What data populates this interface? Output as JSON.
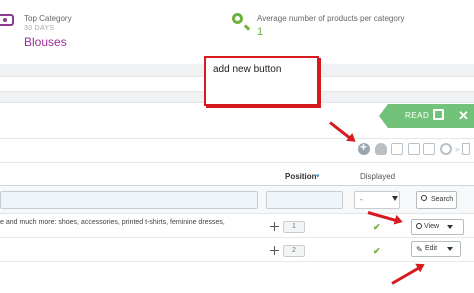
{
  "kpis": {
    "top_category": {
      "label": "Top Category",
      "period": "30 DAYS",
      "value": "Blouses"
    },
    "avg_products": {
      "label": "Average number of products per category",
      "value": "1"
    }
  },
  "panel": {
    "read_label": "READ",
    "toolbar_sql": ">_"
  },
  "table": {
    "headers": {
      "position": "Position",
      "displayed": "Displayed"
    },
    "filter": {
      "displayed_value": "-",
      "search_label": "Search"
    },
    "rows": [
      {
        "description": "e and much more: shoes, accessories, printed t-shirts, feminine dresses,",
        "position": "1",
        "action_label": "View"
      },
      {
        "description": "",
        "position": "2",
        "action_label": "Edit"
      }
    ]
  },
  "annotation": {
    "text": "add new button"
  },
  "colors": {
    "accent_purple": "#9b2d98",
    "accent_green": "#6fb13a",
    "annotation_red": "#d71920",
    "read_green": "#72c279"
  }
}
